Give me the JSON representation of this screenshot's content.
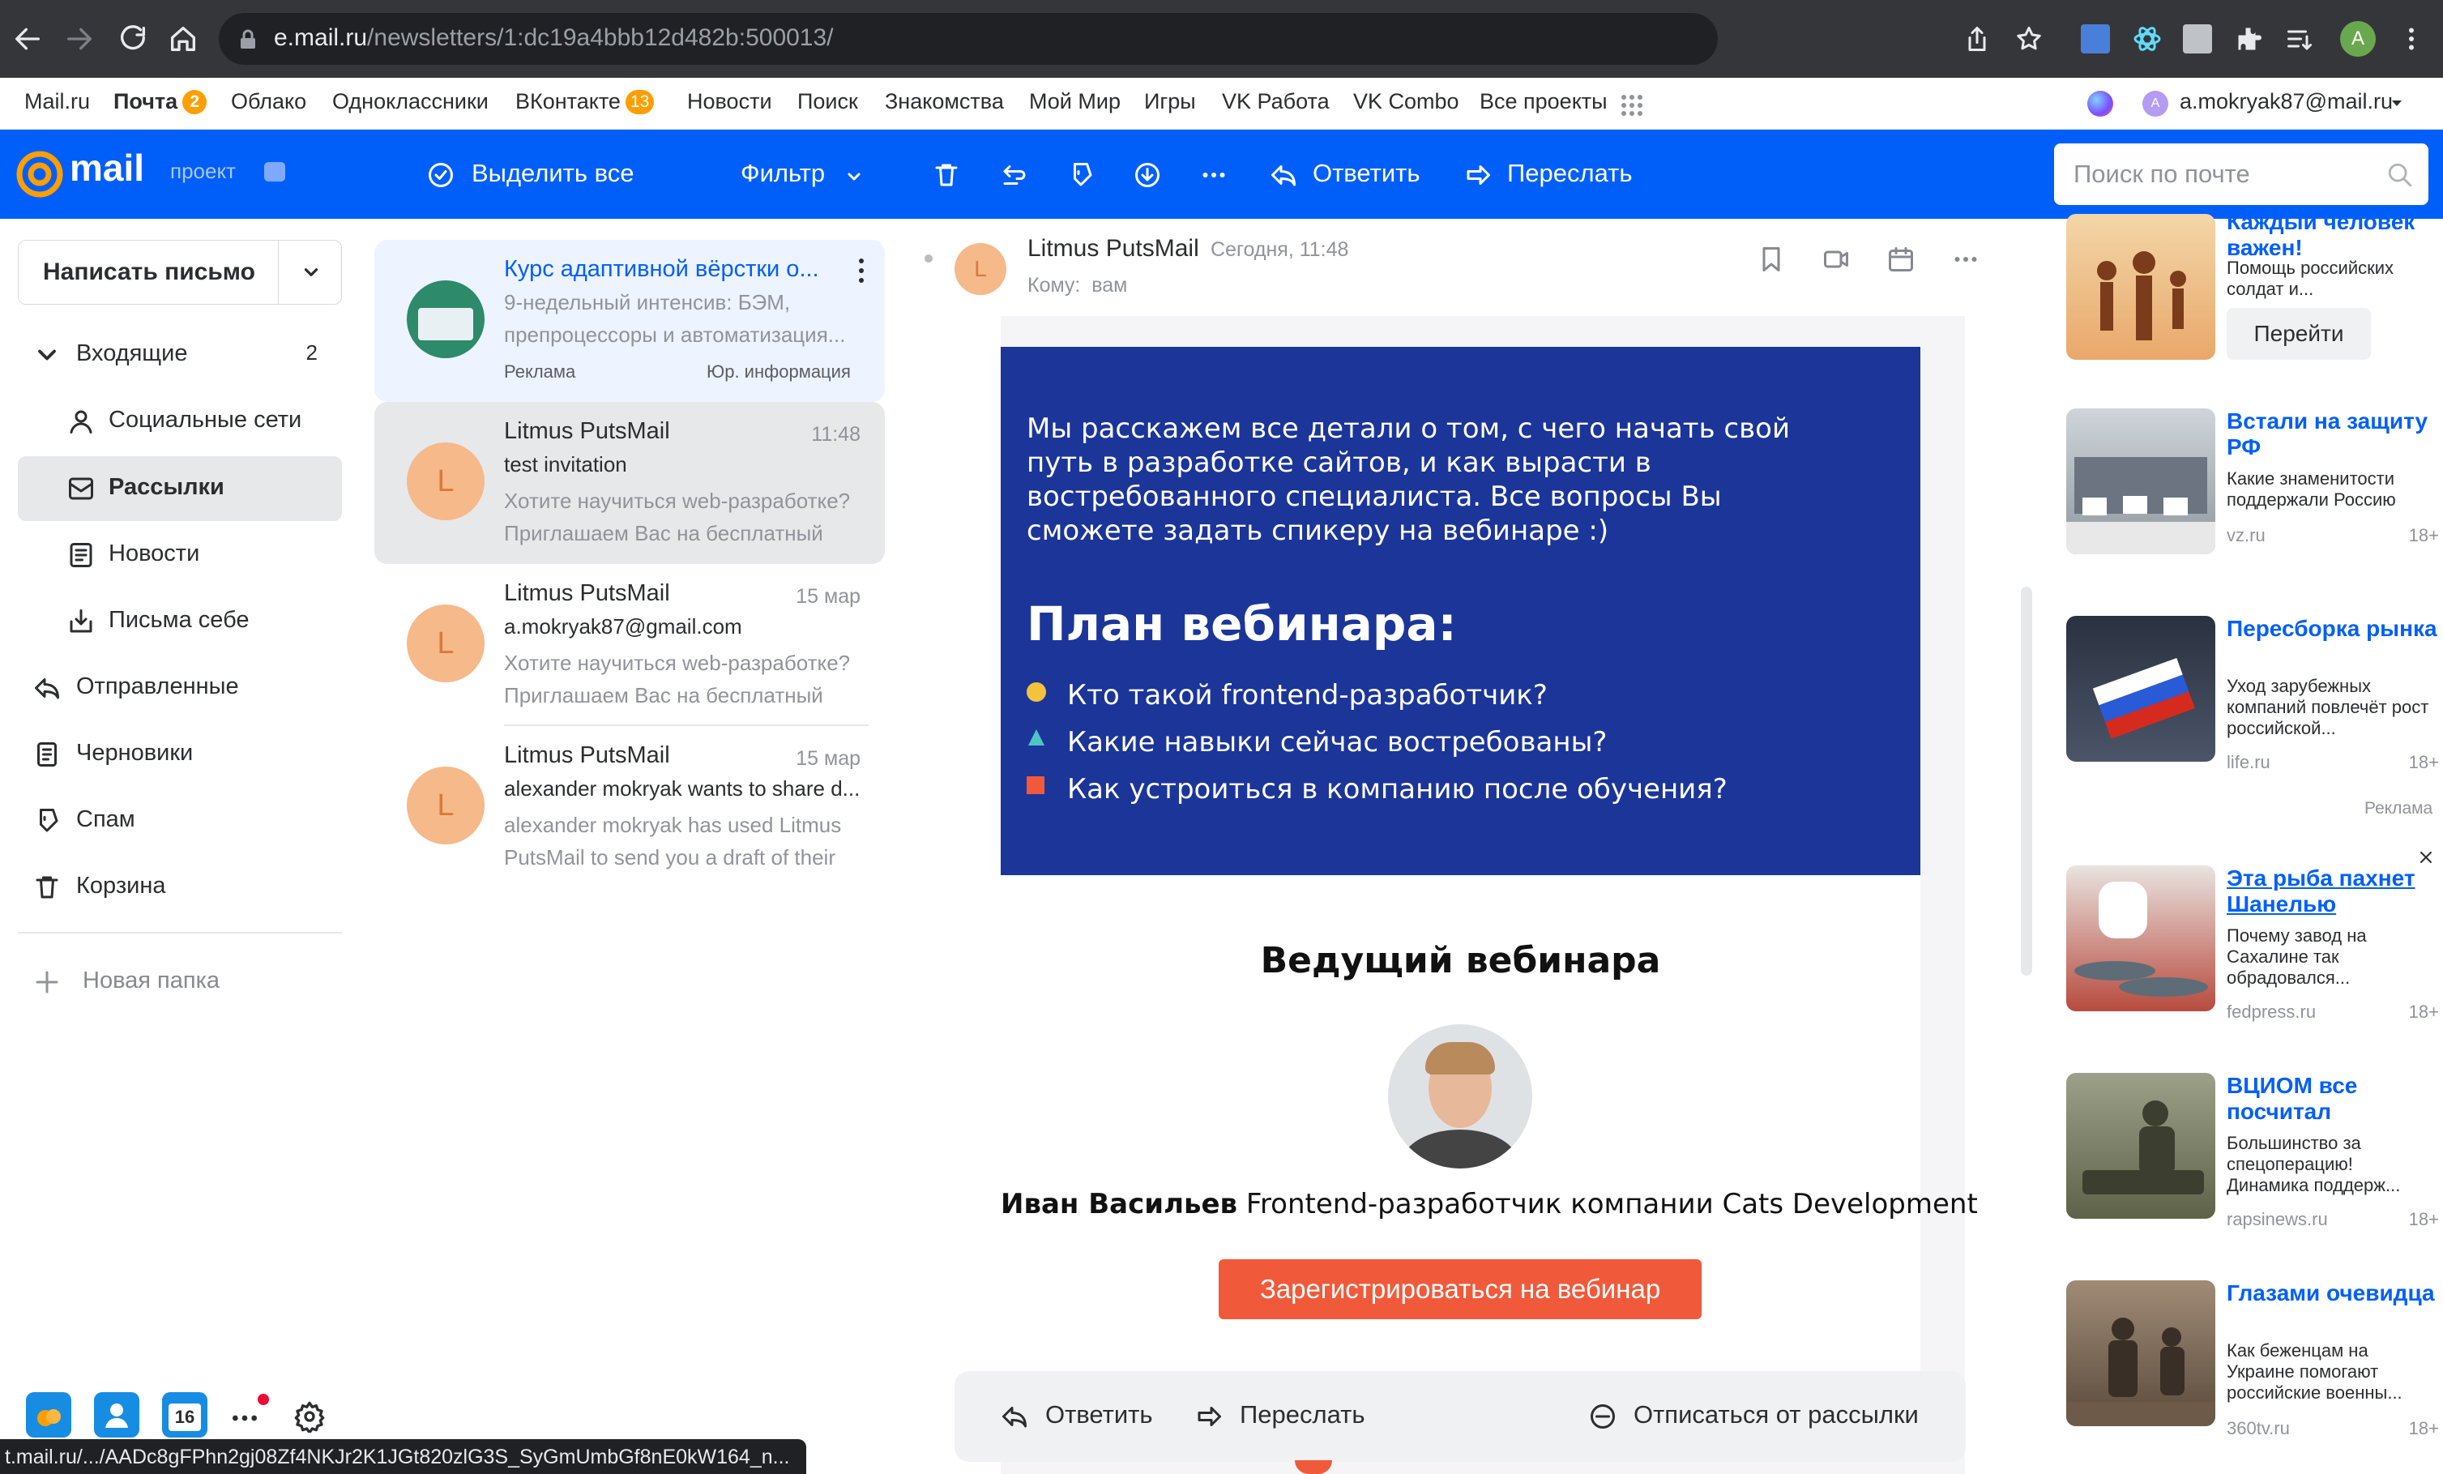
{
  "browser": {
    "url_host": "e.mail.ru",
    "url_path": "/newsletters/1:dc19a4bbb12d482b:500013/",
    "profile_initial": "A",
    "status_url": "t.mail.ru/.../AADc8gFPhn2gj08Zf4NKJr2K1JGt820zlG3S_SyGmUmbGf8nE0kW164_n..."
  },
  "portal": {
    "links": [
      "Mail.ru",
      "Почта",
      "Облако",
      "Одноклассники",
      "ВКонтакте",
      "Новости",
      "Поиск",
      "Знакомства",
      "Мой Мир",
      "Игры",
      "VK Работа",
      "VK Combo",
      "Все проекты"
    ],
    "pochta_badge": "2",
    "vk_badge": "13",
    "account": "a.mokryak87@mail.ru"
  },
  "toolbar": {
    "logo": "mail",
    "project": "проект",
    "select_all": "Выделить все",
    "filter": "Фильтр",
    "reply": "Ответить",
    "forward": "Переслать",
    "search_placeholder": "Поиск по почте"
  },
  "sidebar": {
    "compose": "Написать письмо",
    "inbox": "Входящие",
    "inbox_count": "2",
    "social": "Социальные сети",
    "newsletters": "Рассылки",
    "news": "Новости",
    "self": "Письма себе",
    "sent": "Отправленные",
    "drafts": "Черновики",
    "spam": "Спам",
    "trash": "Корзина",
    "new_folder": "Новая папка"
  },
  "messages": [
    {
      "from": "Курс адаптивной вёрстки о...",
      "subject": "9-недельный интенсив: БЭМ,",
      "snippet": "препроцессоры и автоматизация...",
      "ad": "Реклама",
      "legal": "Юр. информация"
    },
    {
      "from": "Litmus PutsMail",
      "date": "11:48",
      "subject": "test invitation",
      "snippet": "Хотите научиться web-разработке? Приглашаем Вас на бесплатный",
      "avatar": "L"
    },
    {
      "from": "Litmus PutsMail",
      "date": "15 мар",
      "subject": "a.mokryak87@gmail.com",
      "snippet": "Хотите научиться web-разработке? Приглашаем Вас на бесплатный",
      "avatar": "L"
    },
    {
      "from": "Litmus PutsMail",
      "date": "15 мар",
      "subject": "alexander mokryak wants to share d...",
      "snippet": "alexander mokryak has used Litmus PutsMail to send you a draft of their",
      "avatar": "L"
    }
  ],
  "letter": {
    "sender": "Litmus PutsMail",
    "avatar": "L",
    "date": "Сегодня, 11:48",
    "to": "Кому:  вам",
    "intro": "Мы расскажем все детали о том, с чего начать свой путь в разработке сайтов, и как вырасти в востребованного специалиста. Все вопросы Вы сможете задать спикеру на вебинаре :)",
    "plan_title": "План вебинара:",
    "plan": [
      "Кто такой frontend-разработчик?",
      "Какие навыки сейчас востребованы?",
      "Как устроиться в компанию после обучения?"
    ],
    "host_title": "Ведущий вебинара",
    "host_name": "Иван Васильев",
    "host_role": " Frontend-разработчик компании Cats Development",
    "register": "Зарегистрироваться на вебинар",
    "reply": "Ответить",
    "forward": "Переслать",
    "unsubscribe": "Отписаться от рассылки",
    "colors": {
      "banner": "#1c3599",
      "bullet1": "#f5c33b",
      "bullet2": "#4fc3c8",
      "bullet3": "#f05a3a",
      "button": "#f05a3a"
    }
  },
  "ads": [
    {
      "title": "Каждый человек важен!",
      "text": "Помощь российских солдат и...",
      "button": "Перейти"
    },
    {
      "title": "Встали на защиту РФ",
      "text": "Какие знаменитости поддержали Россию",
      "source": "vz.ru",
      "age": "18+"
    },
    {
      "title": "Пересборка рынка",
      "text": "Уход зарубежных компаний повлечёт рост российской...",
      "source": "life.ru",
      "age": "18+"
    },
    {
      "label": "Реклама"
    },
    {
      "title": "Эта рыба пахнет Шанелью",
      "text": "Почему завод на Сахалине так обрадовался...",
      "source": "fedpress.ru",
      "age": "18+"
    },
    {
      "title": "ВЦИОМ все посчитал",
      "text": "Большинство за спецоперацию! Динамика поддерж...",
      "source": "rapsinews.ru",
      "age": "18+"
    },
    {
      "title": "Глазами очевидца",
      "text": "Как беженцам на Украине помогают российские военны...",
      "source": "360tv.ru",
      "age": "18+"
    }
  ],
  "dock": {
    "calendar_day": "16"
  }
}
